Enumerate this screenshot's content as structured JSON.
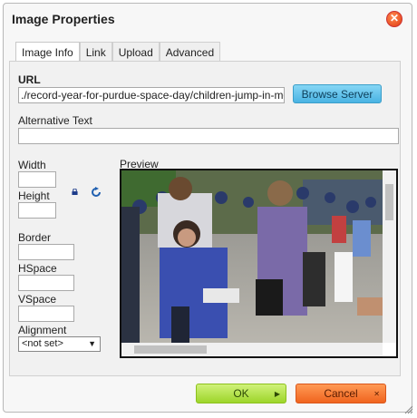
{
  "dialog": {
    "title": "Image Properties",
    "close_symbol": "✕"
  },
  "tabs": [
    {
      "label": "Image Info",
      "active": true
    },
    {
      "label": "Link"
    },
    {
      "label": "Upload"
    },
    {
      "label": "Advanced"
    }
  ],
  "url": {
    "label": "URL",
    "value": "./record-year-for-purdue-space-day/children-jump-in-mo",
    "browse_label": "Browse Server"
  },
  "alt_text": {
    "label": "Alternative Text",
    "value": ""
  },
  "width": {
    "label": "Width",
    "value": ""
  },
  "height": {
    "label": "Height",
    "value": ""
  },
  "border": {
    "label": "Border",
    "value": ""
  },
  "hspace": {
    "label": "HSpace",
    "value": ""
  },
  "vspace": {
    "label": "VSpace",
    "value": ""
  },
  "alignment": {
    "label": "Alignment",
    "selected": "<not set>"
  },
  "preview": {
    "label": "Preview"
  },
  "footer": {
    "ok_label": "OK",
    "cancel_label": "Cancel"
  },
  "colors": {
    "ok": "#9dd52a",
    "cancel": "#f0641e",
    "browse": "#49b3e3",
    "close": "#e03a10"
  }
}
